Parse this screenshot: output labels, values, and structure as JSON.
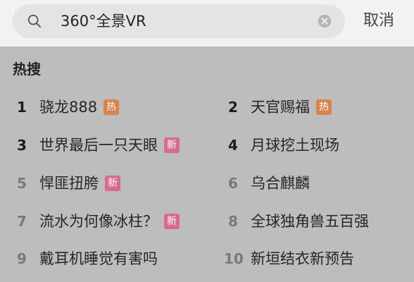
{
  "search": {
    "query": "360°全景VR",
    "cancel_label": "取消"
  },
  "hot": {
    "title": "热搜",
    "items": [
      {
        "rank": "1",
        "label": "骁龙888",
        "badge": "热"
      },
      {
        "rank": "2",
        "label": "天官赐福",
        "badge": "热"
      },
      {
        "rank": "3",
        "label": "世界最后一只天眼",
        "badge": "新"
      },
      {
        "rank": "4",
        "label": "月球挖土现场",
        "badge": ""
      },
      {
        "rank": "5",
        "label": "悍匪扭胯",
        "badge": "新"
      },
      {
        "rank": "6",
        "label": "乌合麒麟",
        "badge": ""
      },
      {
        "rank": "7",
        "label": "流水为何像冰柱？",
        "badge": "新"
      },
      {
        "rank": "8",
        "label": "全球独角兽五百强",
        "badge": ""
      },
      {
        "rank": "9",
        "label": "戴耳机睡觉有害吗",
        "badge": ""
      },
      {
        "rank": "10",
        "label": "新垣结衣新预告",
        "badge": ""
      }
    ]
  },
  "colors": {
    "hot_badge": "#d9824e",
    "new_badge": "#d86a8e",
    "background": "#bdbdbd"
  }
}
